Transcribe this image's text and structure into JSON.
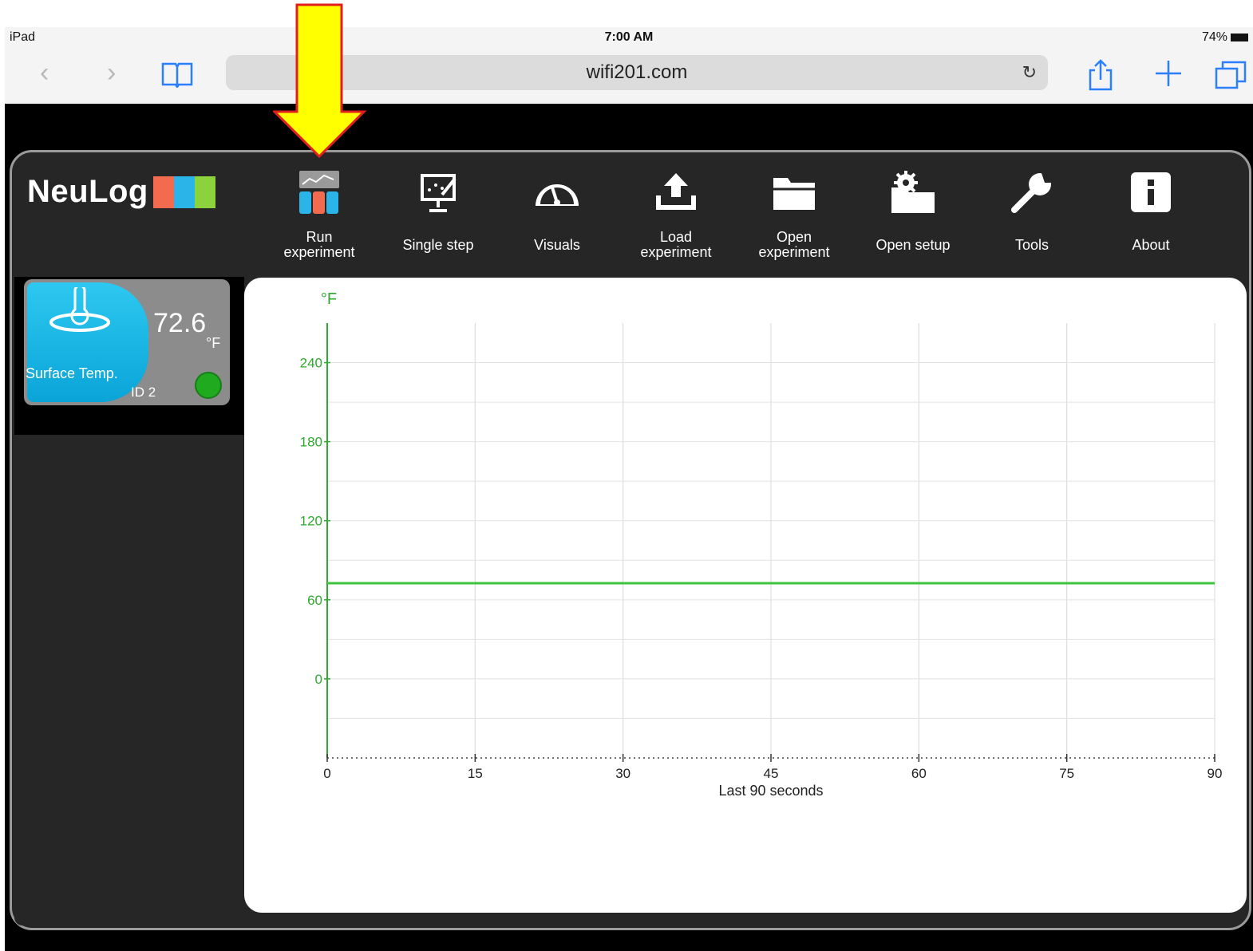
{
  "status_bar": {
    "carrier": "iPad",
    "time": "7:00 AM",
    "battery": "74%"
  },
  "browser": {
    "url": "wifi201.com"
  },
  "app": {
    "logo_text": "NeuLog"
  },
  "toolbar": [
    {
      "id": "run",
      "label_line1": "Run",
      "label_line2": "experiment",
      "icon": "run-experiment-icon"
    },
    {
      "id": "single",
      "label_line1": "Single step",
      "label_line2": "",
      "icon": "single-step-icon"
    },
    {
      "id": "visuals",
      "label_line1": "Visuals",
      "label_line2": "",
      "icon": "gauge-icon"
    },
    {
      "id": "load",
      "label_line1": "Load",
      "label_line2": "experiment",
      "icon": "upload-tray-icon"
    },
    {
      "id": "open",
      "label_line1": "Open",
      "label_line2": "experiment",
      "icon": "folder-icon"
    },
    {
      "id": "setup",
      "label_line1": "Open setup",
      "label_line2": "",
      "icon": "gear-folder-icon"
    },
    {
      "id": "tools",
      "label_line1": "Tools",
      "label_line2": "",
      "icon": "wrench-icon"
    },
    {
      "id": "about",
      "label_line1": "About",
      "label_line2": "",
      "icon": "info-icon"
    }
  ],
  "sensor": {
    "value": "72.6",
    "unit": "°F",
    "name": "Surface Temp.",
    "id_label": "ID 2",
    "status_color": "#1faa1f"
  },
  "chart_data": {
    "type": "line",
    "ylabel": "°F",
    "xlabel": "Last 90 seconds",
    "xlim": [
      0,
      90
    ],
    "ylim": [
      -60,
      270
    ],
    "x_ticks": [
      0,
      15,
      30,
      45,
      60,
      75,
      90
    ],
    "y_ticks": [
      0,
      60,
      120,
      180,
      240
    ],
    "series": [
      {
        "color": "#3cc43c",
        "x": [
          0,
          15,
          30,
          45,
          60,
          75,
          90
        ],
        "y": [
          72.6,
          72.6,
          72.6,
          72.6,
          72.6,
          72.6,
          72.6
        ]
      }
    ],
    "grid": true
  },
  "colors": {
    "annotation_fill": "#ffff00",
    "annotation_stroke": "#e02020",
    "axis_color": "#2eaa2e"
  }
}
